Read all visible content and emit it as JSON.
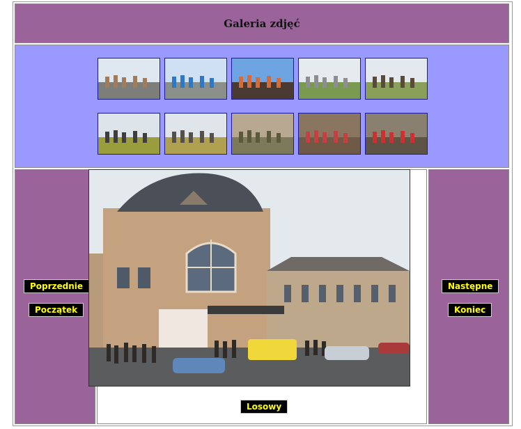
{
  "header": {
    "title": "Galeria zdjęć"
  },
  "thumbnails": [
    {
      "name": "thumb-station-building",
      "sky": "#dfe7f1",
      "ground": "#7d7d7a",
      "subject": "#a07c5b"
    },
    {
      "name": "thumb-train-platform",
      "sky": "#cfe0f3",
      "ground": "#8a8f8a",
      "subject": "#2f78c8"
    },
    {
      "name": "thumb-tuchow-sign-crowd",
      "sky": "#6fa4e3",
      "ground": "#4a3a32",
      "subject": "#d26d3b"
    },
    {
      "name": "thumb-road-village",
      "sky": "#e6ebf0",
      "ground": "#7a9a52",
      "subject": "#8d8d93"
    },
    {
      "name": "thumb-hill-walkers",
      "sky": "#e3e9ef",
      "ground": "#8aa05a",
      "subject": "#5a4a3a"
    },
    {
      "name": "thumb-field-group",
      "sky": "#dde4ea",
      "ground": "#9a9c3e",
      "subject": "#3e3e3e"
    },
    {
      "name": "thumb-field-crowd",
      "sky": "#dfe5e9",
      "ground": "#b0a150",
      "subject": "#55504a"
    },
    {
      "name": "thumb-soldiers-crowd",
      "sky": "#b8a892",
      "ground": "#7c7a5a",
      "subject": "#5a5a3a"
    },
    {
      "name": "thumb-cemetery",
      "sky": "#8a7560",
      "ground": "#6f5a48",
      "subject": "#c54040"
    },
    {
      "name": "thumb-memorial-flag",
      "sky": "#8a8070",
      "ground": "#5e5445",
      "subject": "#cc3030"
    }
  ],
  "buttons": {
    "previous": "Poprzednie",
    "start": "Początek",
    "next": "Następne",
    "end": "Koniec",
    "random": "Losowy"
  },
  "colors": {
    "header_bg": "#9a6399",
    "thumbs_bg": "#9999ff",
    "button_bg": "#000000",
    "button_text": "#ffff00"
  }
}
